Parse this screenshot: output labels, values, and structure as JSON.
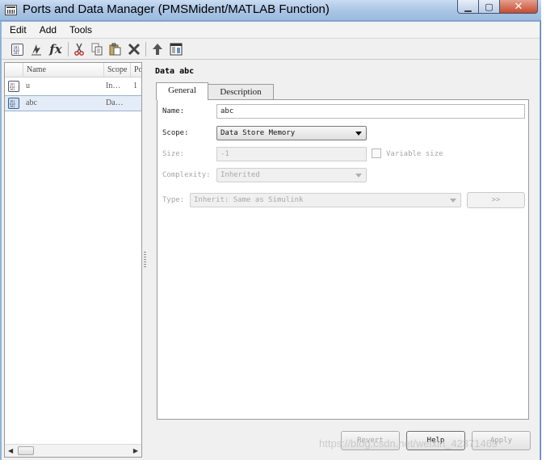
{
  "window": {
    "title": "Ports and Data Manager (PMSMident/MATLAB Function)",
    "minimize_glyph": "▁",
    "maximize_glyph": "▢",
    "close_glyph": "✕"
  },
  "menu": {
    "items": [
      "Edit",
      "Add",
      "Tools"
    ]
  },
  "toolbar": {
    "icons": [
      "add-data-icon",
      "add-event-icon",
      "add-function-icon",
      "cut-icon",
      "copy-icon",
      "paste-icon",
      "delete-icon",
      "move-up-icon",
      "model-explorer-icon"
    ],
    "fx_label": "fx",
    "data_glyph": "101\n010\n101"
  },
  "list": {
    "columns": [
      "Name",
      "Scope",
      "Po"
    ],
    "rows": [
      {
        "name": "u",
        "scope": "In…",
        "port": "1",
        "selected": false
      },
      {
        "name": "abc",
        "scope": "Da…",
        "port": "",
        "selected": true
      }
    ],
    "scroll_left": "◀",
    "scroll_right": "▶"
  },
  "detail": {
    "title": "Data abc",
    "tabs": [
      "General",
      "Description"
    ],
    "active_tab": "General",
    "name_label": "Name:",
    "name_value": "abc",
    "scope_label": "Scope:",
    "scope_value": "Data Store Memory",
    "size_label": "Size:",
    "size_value": "-1",
    "variable_size_label": "Variable size",
    "complexity_label": "Complexity:",
    "complexity_value": "Inherited",
    "type_label": "Type:",
    "type_value": "Inherit: Same as Simulink",
    "type_button_label": ">>"
  },
  "buttons": {
    "revert": "Revert",
    "help": "Help",
    "apply": "Apply"
  },
  "watermark": "https://blog.csdn.net/weixin_42371469"
}
